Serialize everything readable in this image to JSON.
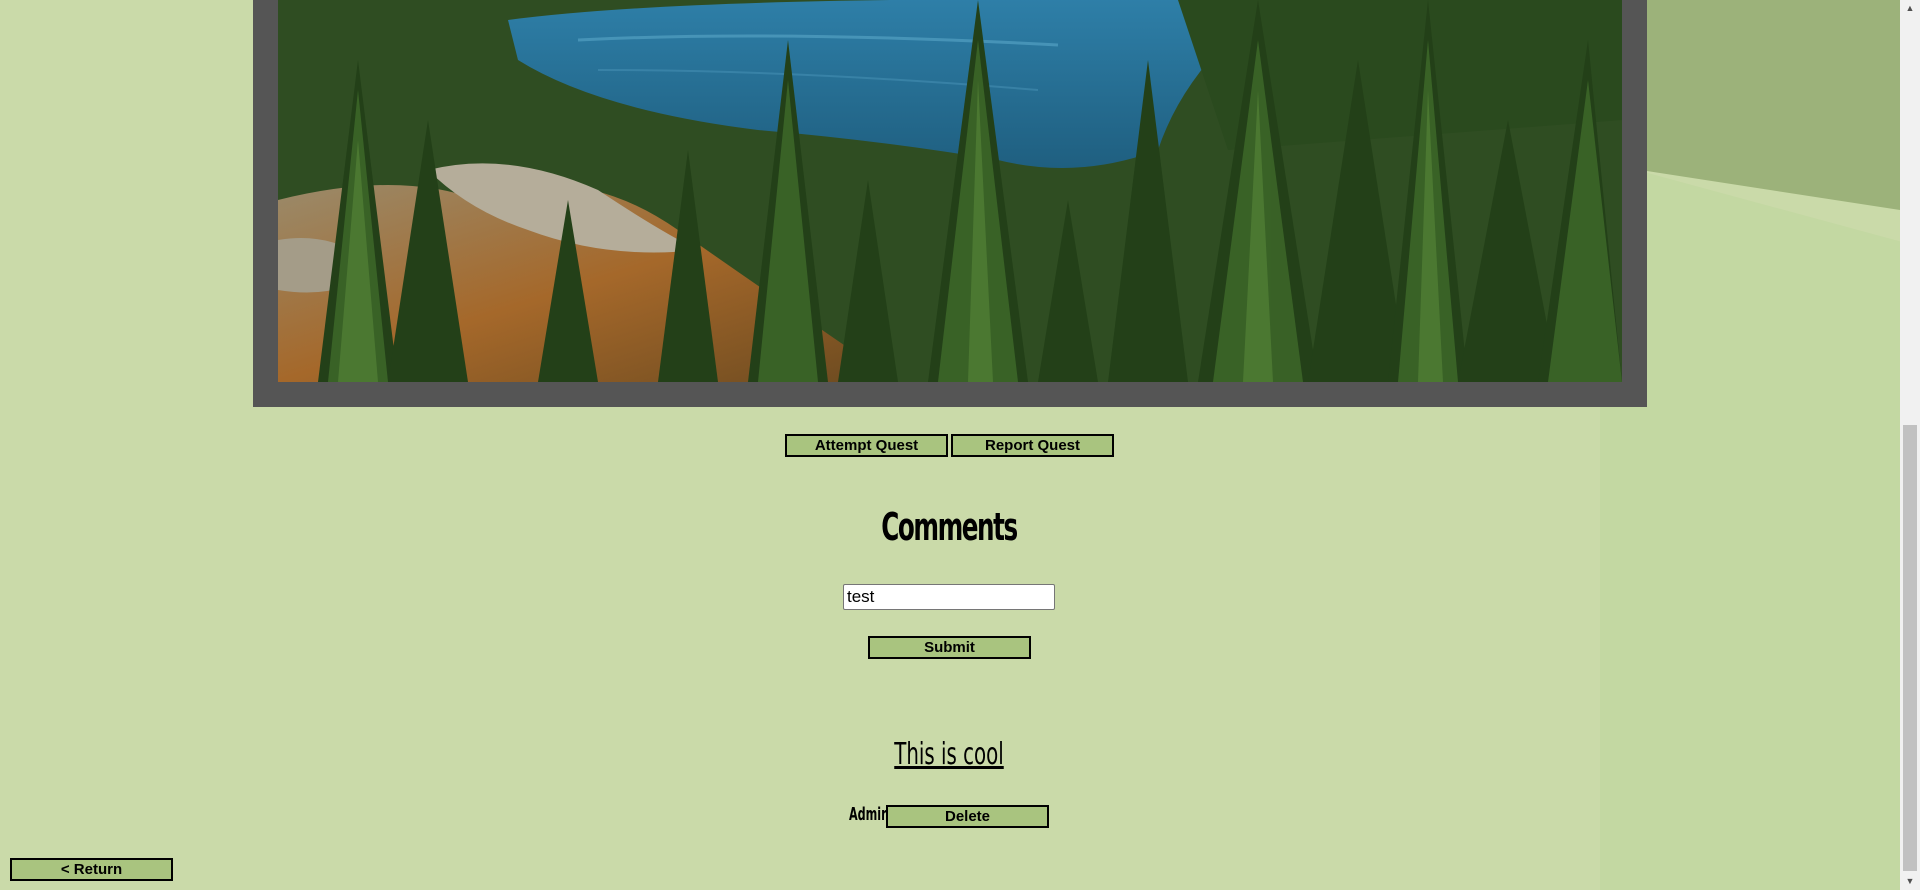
{
  "actions": {
    "attempt_label": "Attempt Quest",
    "report_label": "Report Quest"
  },
  "comments": {
    "title": "Comments",
    "input_value": "test",
    "submit_label": "Submit",
    "items": [
      {
        "text": "This is cool",
        "author": "Admin",
        "delete_label": "Delete"
      }
    ]
  },
  "nav": {
    "return_label": "< Return"
  },
  "scrollbar": {
    "up_icon": "up-arrow-icon",
    "down_icon": "down-arrow-icon"
  },
  "colors": {
    "background": "#cadaa9",
    "button": "#a9c47f",
    "frame": "#555555"
  }
}
